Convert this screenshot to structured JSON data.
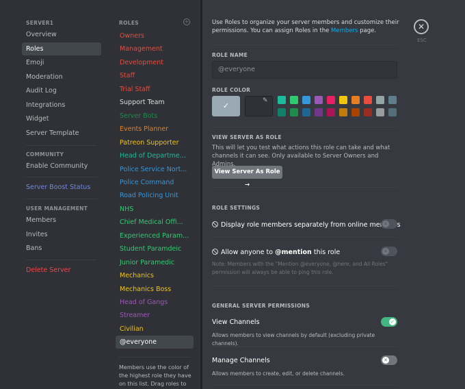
{
  "sidebar": {
    "server_header": "SERVER1",
    "items_top": [
      {
        "label": "Overview"
      },
      {
        "label": "Roles"
      },
      {
        "label": "Emoji"
      },
      {
        "label": "Moderation"
      },
      {
        "label": "Audit Log"
      },
      {
        "label": "Integrations"
      },
      {
        "label": "Widget"
      },
      {
        "label": "Server Template"
      }
    ],
    "community_header": "COMMUNITY",
    "enable_community": "Enable Community",
    "boost_status": "Server Boost Status",
    "user_mgmt_header": "USER MANAGEMENT",
    "items_users": [
      {
        "label": "Members"
      },
      {
        "label": "Invites"
      },
      {
        "label": "Bans"
      }
    ],
    "delete_server": "Delete Server"
  },
  "roles_panel": {
    "header": "ROLES",
    "roles": [
      {
        "label": "Owners",
        "color": "#e74c3c"
      },
      {
        "label": "Management",
        "color": "#e74c3c"
      },
      {
        "label": "Development",
        "color": "#e74c3c"
      },
      {
        "label": "Staff",
        "color": "#e74c3c"
      },
      {
        "label": "Trial Staff",
        "color": "#e74c3c"
      },
      {
        "label": "Support Team",
        "color": "#dcddde"
      },
      {
        "label": "Server Bots",
        "color": "#1f8b4c"
      },
      {
        "label": "Events Planner",
        "color": "#e67e22"
      },
      {
        "label": "Patreon Supporter",
        "color": "#f1c40f"
      },
      {
        "label": "Head of Departme...",
        "color": "#1abc9c"
      },
      {
        "label": "Police Service Nort...",
        "color": "#3498db"
      },
      {
        "label": "Police Command",
        "color": "#3498db"
      },
      {
        "label": "Road Policing Unit",
        "color": "#3498db"
      },
      {
        "label": "NHS",
        "color": "#2ecc71"
      },
      {
        "label": "Chief Medical Offi...",
        "color": "#2ecc71"
      },
      {
        "label": "Experienced Param...",
        "color": "#2ecc71"
      },
      {
        "label": "Student Paramdeic",
        "color": "#2ecc71"
      },
      {
        "label": "Junior Paramedic",
        "color": "#2ecc71"
      },
      {
        "label": "Mechanics",
        "color": "#f1c40f"
      },
      {
        "label": "Mechanics Boss",
        "color": "#f1c40f"
      },
      {
        "label": "Head of Gangs",
        "color": "#9b59b6"
      },
      {
        "label": "Streamer",
        "color": "#9b59b6"
      },
      {
        "label": "Civilian",
        "color": "#f1c40f"
      },
      {
        "label": "@everyone",
        "color": "#ffffff"
      }
    ],
    "footer": "Members use the color of the highest role they have on this list. Drag roles to reorder them."
  },
  "main": {
    "intro_text_1": "Use Roles to organize your server members and customize their permissions. You can assign Roles in the",
    "intro_link": "Members",
    "intro_text_2": "page.",
    "esc_label": "ESC",
    "role_name_label": "ROLE NAME",
    "role_name_value": "@everyone",
    "role_color_label": "ROLE COLOR",
    "color_swatches": [
      "#1abc9c",
      "#2ecc71",
      "#3498db",
      "#9b59b6",
      "#e91e63",
      "#f1c40f",
      "#e67e22",
      "#e74c3c",
      "#95a5a6",
      "#607d8b",
      "#11806a",
      "#1f8b4c",
      "#206694",
      "#71368a",
      "#ad1457",
      "#c27c0e",
      "#a84300",
      "#992d22",
      "#979c9f",
      "#546e7a"
    ],
    "view_as_label": "VIEW SERVER AS ROLE",
    "view_as_desc": "This will let you test what actions this role can take and what channels it can see. Only available to Server Owners and Admins.",
    "view_as_button": "View Server As Role →",
    "role_settings_label": "ROLE SETTINGS",
    "display_separately": "Display role members separately from online members",
    "allow_mention_prefix": "Allow anyone to",
    "allow_mention_bold": "@mention",
    "allow_mention_suffix": "this role",
    "mention_note": "Note: Members with the \"Mention @everyone, @here, and All Roles\" permission will always be able to ping this role.",
    "general_perms_label": "GENERAL SERVER PERMISSIONS",
    "view_channels_title": "View Channels",
    "view_channels_desc": "Allows members to view channels by default (excluding private channels).",
    "manage_channels_title": "Manage Channels",
    "manage_channels_desc": "Allows members to create, edit, or delete channels."
  }
}
